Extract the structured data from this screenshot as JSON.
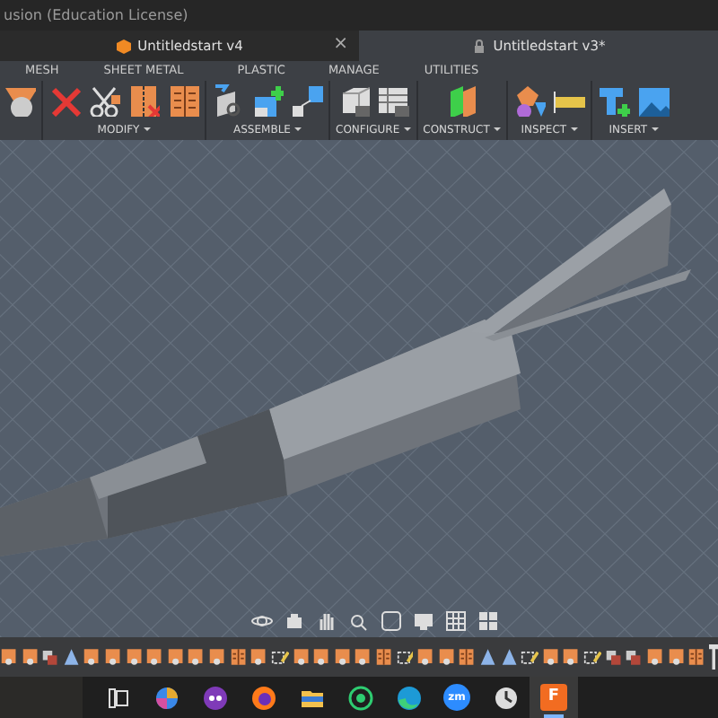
{
  "window": {
    "title": "usion (Education License)"
  },
  "document_tabs": [
    {
      "label": "Untitledstart v4",
      "selected": false,
      "close": "×"
    },
    {
      "label": "Untitledstart v3*",
      "selected": true
    }
  ],
  "toolbar_tabs": [
    "MESH",
    "SHEET METAL",
    "PLASTIC",
    "MANAGE",
    "UTILITIES"
  ],
  "tool_groups": [
    {
      "label": "MODIFY"
    },
    {
      "label": "ASSEMBLE"
    },
    {
      "label": "CONFIGURE"
    },
    {
      "label": "CONSTRUCT"
    },
    {
      "label": "INSPECT"
    },
    {
      "label": "INSERT"
    }
  ],
  "taskbar": [
    {
      "kind": "taskview",
      "selected": false
    },
    {
      "kind": "copilot",
      "selected": false
    },
    {
      "kind": "app",
      "selected": false
    },
    {
      "kind": "firefox",
      "selected": false
    },
    {
      "kind": "folder",
      "selected": false
    },
    {
      "kind": "whatsapp",
      "selected": false
    },
    {
      "kind": "edge",
      "selected": false
    },
    {
      "kind": "zoom",
      "text": "zm",
      "selected": false
    },
    {
      "kind": "clock",
      "selected": false
    },
    {
      "kind": "fusion",
      "text": "F",
      "selected": true
    }
  ]
}
